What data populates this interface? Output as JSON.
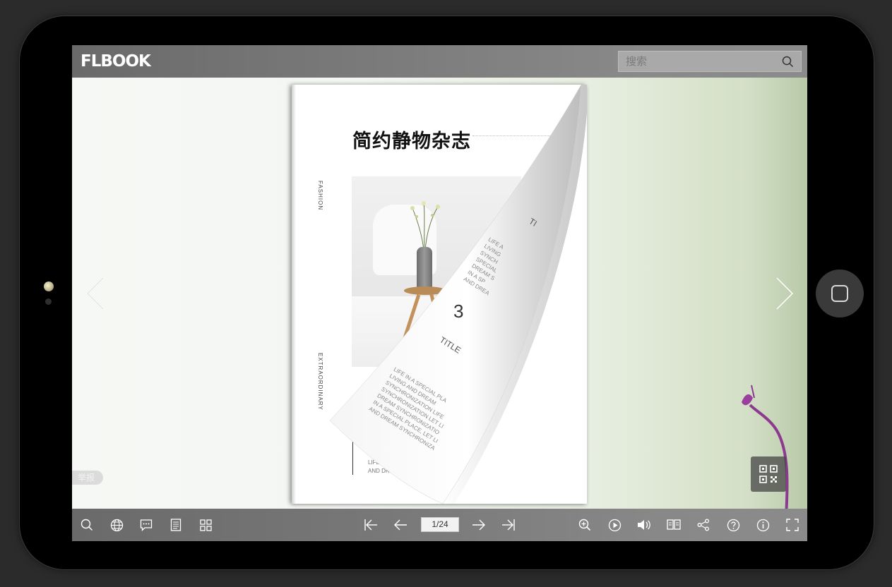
{
  "app": {
    "logo_text": "FLBOOK"
  },
  "search": {
    "placeholder": "搜索",
    "icon": "search-icon"
  },
  "magazine": {
    "title": "简约静物杂志",
    "side_top": "FASHION",
    "side_bottom": "EXTRAORDINARY",
    "bottom_text_1": "LIFE IN A",
    "bottom_text_2": "AND DREAM",
    "curl_number": "3",
    "curl_title": "TITLE",
    "curl_lines": [
      "LIFE IN A SPECIAL PLA",
      "LIVING AND DREAM",
      "SYNCHRONIZATION LIFE",
      "SYNCHRONIZATION LET LI",
      "DREAM SYNCHRONIZATIO",
      "IN A SPECIAL PLACE, LET LI",
      "AND DREAM SYNCHRONIZA"
    ],
    "curl_top_title": "TI",
    "curl_top_lines": [
      "LIFE A",
      "LIVING",
      "SYNCH",
      "SPECIAL",
      "DREAM S",
      "IN A SP",
      "AND DREA"
    ]
  },
  "report_label": "举报",
  "pagination": {
    "current": "1/24"
  },
  "toolbar_left": [
    "search-icon",
    "globe-icon",
    "comment-icon",
    "document-icon",
    "grid-icon"
  ],
  "toolbar_center": [
    "first-page-icon",
    "prev-page-icon",
    "next-page-icon",
    "last-page-icon"
  ],
  "toolbar_right": [
    "zoom-in-icon",
    "play-icon",
    "volume-icon",
    "double-page-icon",
    "share-icon",
    "help-icon",
    "info-icon",
    "fullscreen-icon"
  ],
  "colors": {
    "toolbar": "#777777",
    "accent_flower": "#8b3a8f",
    "background": "#2b2b2b"
  }
}
